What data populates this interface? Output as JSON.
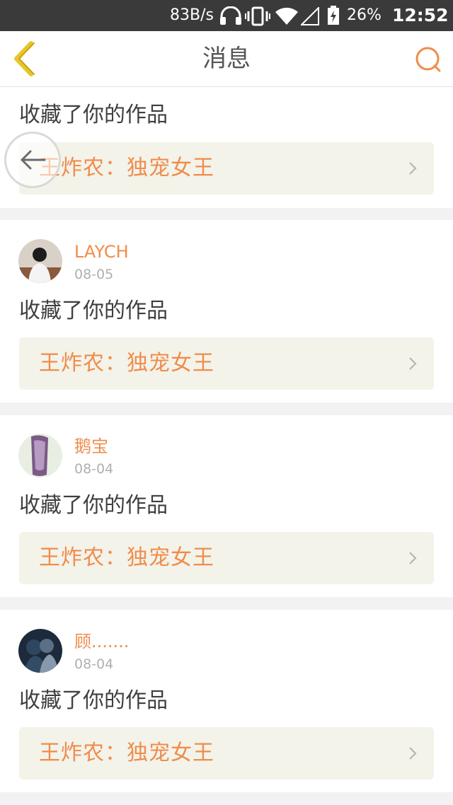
{
  "status_bar": {
    "net_speed": "83B/s",
    "battery": "26%",
    "time": "12:52"
  },
  "header": {
    "title": "消息"
  },
  "colors": {
    "accent": "#f08c4b",
    "back_arrow": "#e8c62a",
    "work_box_bg": "#f3f3ea"
  },
  "icons": {
    "back": "chevron-left-icon",
    "search": "search-icon",
    "gesture_back": "arrow-left-icon",
    "go": "chevron-right-icon"
  },
  "messages": [
    {
      "user": "",
      "date": "",
      "action": "收藏了你的作品",
      "work": "王炸农：独宠女王"
    },
    {
      "user": "LAYCH",
      "date": "08-05",
      "action": "收藏了你的作品",
      "work": "王炸农：独宠女王"
    },
    {
      "user": "鹅宝",
      "date": "08-04",
      "action": "收藏了你的作品",
      "work": "王炸农：独宠女王"
    },
    {
      "user": "顾.......",
      "date": "08-04",
      "action": "收藏了你的作品",
      "work": "王炸农：独宠女王"
    }
  ]
}
